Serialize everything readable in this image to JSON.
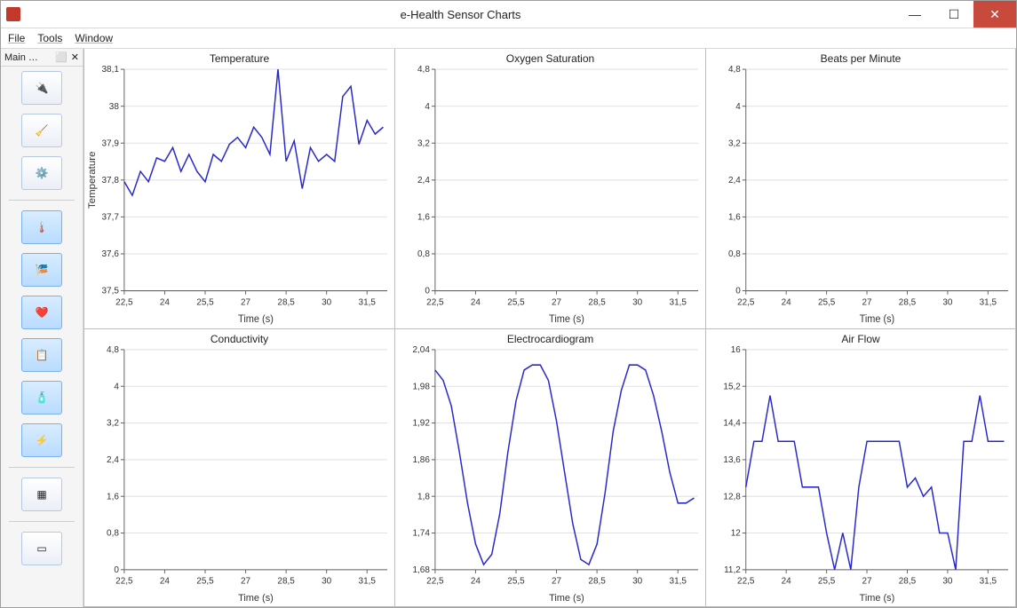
{
  "window": {
    "title": "e-Health Sensor Charts",
    "menubar": {
      "file": "File",
      "tools": "Tools",
      "window": "Window"
    },
    "sidebar_header": "Main …",
    "sidebar_controls": {
      "float": "⬜",
      "close": "✕"
    }
  },
  "icons": {
    "plug": "plug-icon",
    "broom": "broom-icon",
    "gear": "gear-icon",
    "thermometer": "thermometer-icon",
    "windsock": "windsock-icon",
    "heart": "heart-icon",
    "clipboard": "clipboard-icon",
    "bottle": "bottle-icon",
    "bolt": "bolt-icon",
    "grid": "grid-icon",
    "single": "window-icon"
  },
  "chart_data": [
    {
      "key": "temperature",
      "title": "Temperature",
      "xlabel": "Time (s)",
      "ylabel": "Temperature",
      "type": "line",
      "x_ticks": [
        "22,5",
        "24",
        "25,5",
        "27",
        "28,5",
        "30",
        "31,5"
      ],
      "ylim": [
        37.5,
        38.15
      ],
      "y_ticks": [
        "37,5",
        "37,6",
        "37,7",
        "37,8",
        "37,9",
        "38",
        "38,1"
      ],
      "x": [
        22.5,
        22.8,
        23.1,
        23.4,
        23.7,
        24.0,
        24.3,
        24.6,
        24.9,
        25.2,
        25.5,
        25.8,
        26.1,
        26.4,
        26.7,
        27.0,
        27.3,
        27.6,
        27.9,
        28.2,
        28.5,
        28.8,
        29.1,
        29.4,
        29.7,
        30.0,
        30.3,
        30.6,
        30.9,
        31.2,
        31.5,
        31.8,
        32.1
      ],
      "values": [
        37.82,
        37.78,
        37.85,
        37.82,
        37.89,
        37.88,
        37.92,
        37.85,
        37.9,
        37.85,
        37.82,
        37.9,
        37.88,
        37.93,
        37.95,
        37.92,
        37.98,
        37.95,
        37.9,
        38.15,
        37.88,
        37.94,
        37.8,
        37.92,
        37.88,
        37.9,
        37.88,
        38.07,
        38.1,
        37.93,
        38.0,
        37.96,
        37.98
      ]
    },
    {
      "key": "oxygen",
      "title": "Oxygen Saturation",
      "xlabel": "Time (s)",
      "ylabel": "",
      "type": "line",
      "x_ticks": [
        "22,5",
        "24",
        "25,5",
        "27",
        "28,5",
        "30",
        "31,5"
      ],
      "ylim": [
        0,
        5
      ],
      "y_ticks": [
        "0",
        "0,8",
        "1,6",
        "2,4",
        "3,2",
        "4",
        "4,8"
      ],
      "x": [],
      "values": []
    },
    {
      "key": "bpm",
      "title": "Beats per Minute",
      "xlabel": "Time (s)",
      "ylabel": "",
      "type": "line",
      "x_ticks": [
        "22,5",
        "24",
        "25,5",
        "27",
        "28,5",
        "30",
        "31,5"
      ],
      "ylim": [
        0,
        5
      ],
      "y_ticks": [
        "0",
        "0,8",
        "1,6",
        "2,4",
        "3,2",
        "4",
        "4,8"
      ],
      "x": [],
      "values": []
    },
    {
      "key": "conductivity",
      "title": "Conductivity",
      "xlabel": "Time (s)",
      "ylabel": "",
      "type": "line",
      "x_ticks": [
        "22,5",
        "24",
        "25,5",
        "27",
        "28,5",
        "30",
        "31,5"
      ],
      "ylim": [
        0,
        5
      ],
      "y_ticks": [
        "0",
        "0,8",
        "1,6",
        "2,4",
        "3,2",
        "4",
        "4,8"
      ],
      "x": [],
      "values": []
    },
    {
      "key": "ecg",
      "title": "Electrocardiogram",
      "xlabel": "Time (s)",
      "ylabel": "",
      "type": "line",
      "x_ticks": [
        "22,5",
        "24",
        "25,5",
        "27",
        "28,5",
        "30",
        "31,5"
      ],
      "ylim": [
        1.63,
        2.06
      ],
      "y_ticks": [
        "1,68",
        "1,74",
        "1,8",
        "1,86",
        "1,92",
        "1,98",
        "2,04"
      ],
      "x": [
        22.5,
        22.8,
        23.1,
        23.4,
        23.7,
        24.0,
        24.3,
        24.6,
        24.9,
        25.2,
        25.5,
        25.8,
        26.1,
        26.4,
        26.7,
        27.0,
        27.3,
        27.6,
        27.9,
        28.2,
        28.5,
        28.8,
        29.1,
        29.4,
        29.7,
        30.0,
        30.3,
        30.6,
        30.9,
        31.2,
        31.5,
        31.8,
        32.1
      ],
      "values": [
        2.02,
        2.0,
        1.95,
        1.86,
        1.76,
        1.68,
        1.64,
        1.66,
        1.74,
        1.86,
        1.96,
        2.02,
        2.03,
        2.03,
        2.0,
        1.92,
        1.82,
        1.72,
        1.65,
        1.64,
        1.68,
        1.78,
        1.9,
        1.98,
        2.03,
        2.03,
        2.02,
        1.97,
        1.9,
        1.82,
        1.76,
        1.76,
        1.77
      ]
    },
    {
      "key": "airflow",
      "title": "Air Flow",
      "xlabel": "Time (s)",
      "ylabel": "",
      "type": "line",
      "x_ticks": [
        "22,5",
        "24",
        "25,5",
        "27",
        "28,5",
        "30",
        "31,5"
      ],
      "ylim": [
        11.2,
        16
      ],
      "y_ticks": [
        "11,2",
        "12",
        "12,8",
        "13,6",
        "14,4",
        "15,2",
        "16"
      ],
      "x": [
        22.5,
        22.8,
        23.1,
        23.4,
        23.7,
        24.0,
        24.3,
        24.6,
        24.9,
        25.2,
        25.5,
        25.8,
        26.1,
        26.4,
        26.7,
        27.0,
        27.3,
        27.6,
        27.9,
        28.2,
        28.5,
        28.8,
        29.1,
        29.4,
        29.7,
        30.0,
        30.3,
        30.6,
        30.9,
        31.2,
        31.5,
        31.8,
        32.1
      ],
      "values": [
        13.0,
        14.0,
        14.0,
        15.0,
        14.0,
        14.0,
        14.0,
        13.0,
        13.0,
        13.0,
        12.0,
        11.2,
        12.0,
        11.2,
        13.0,
        14.0,
        14.0,
        14.0,
        14.0,
        14.0,
        13.0,
        13.2,
        12.8,
        13.0,
        12.0,
        12.0,
        11.2,
        14.0,
        14.0,
        15.0,
        14.0,
        14.0,
        14.0
      ]
    }
  ]
}
